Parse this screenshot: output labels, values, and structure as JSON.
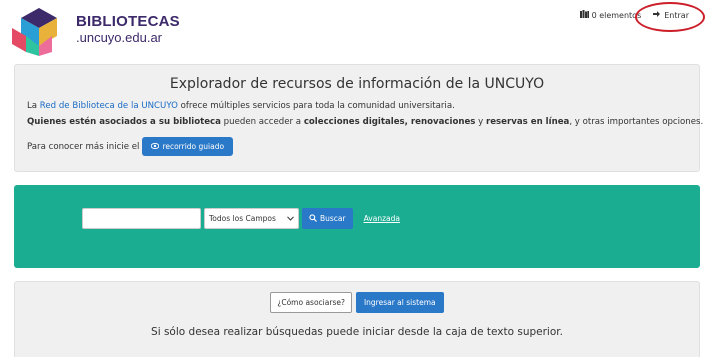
{
  "header": {
    "brand_main": "BIBLIOTECAS",
    "brand_sub": ".uncuyo.edu.ar",
    "cart_label": "0 elementos",
    "login_label": "Entrar"
  },
  "info": {
    "title": "Explorador de recursos de información de la UNCUYO",
    "line1_pre": "La ",
    "line1_link": "Red de Biblioteca de la UNCUYO",
    "line1_post": " ofrece múltiples servicios para toda la comunidad universitaria.",
    "line2_b1": "Quienes estén asociados a su biblioteca",
    "line2_t1": " pueden acceder a ",
    "line2_b2": "colecciones digitales, renovaciones",
    "line2_t2": " y ",
    "line2_b3": "reservas en línea",
    "line2_t3": ", y otras importantes opciones.",
    "line3_text": "Para conocer más inicie el",
    "guide_button": "recorrido guiado"
  },
  "search": {
    "input_value": "",
    "field_selected": "Todos los Campos",
    "search_button": "Buscar",
    "advanced_link": "Avanzada"
  },
  "bottom": {
    "associate_button": "¿Cómo asociarse?",
    "login_button": "Ingresar al sistema",
    "text": "Si sólo desea realizar búsquedas puede iniciar desde la caja de texto superior."
  },
  "colors": {
    "brand": "#3d2a6a",
    "accent_blue": "#2a78c8",
    "search_panel": "#1bad91",
    "annotation_ring": "#cc1f2a"
  }
}
